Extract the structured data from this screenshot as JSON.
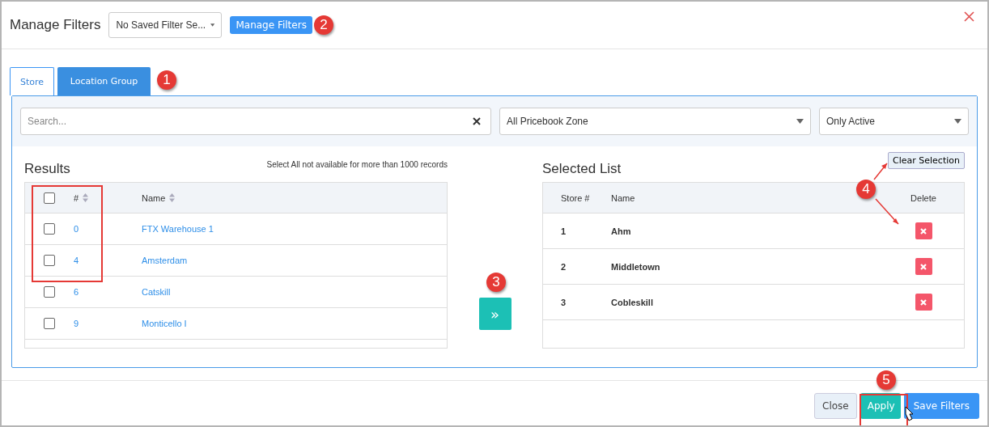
{
  "dialog": {
    "title": "Manage Filters",
    "saved_filter_select": {
      "value": "No Saved Filter Se..."
    },
    "manage_filters_button": "Manage Filters"
  },
  "tabs": [
    {
      "label": "Store",
      "selected": true
    },
    {
      "label": "Location Group",
      "selected": false
    }
  ],
  "filters": {
    "search": {
      "placeholder": "Search..."
    },
    "zone_select": {
      "value": "All Pricebook Zone"
    },
    "status_select": {
      "value": "Only Active"
    }
  },
  "results": {
    "title": "Results",
    "note": "Select All not available for more than 1000 records",
    "columns": [
      "#",
      "Name"
    ],
    "select_all_checked": false,
    "rows": [
      {
        "number": "0",
        "name": "FTX Warehouse 1",
        "checked": false
      },
      {
        "number": "4",
        "name": "Amsterdam",
        "checked": false
      },
      {
        "number": "6",
        "name": "Catskill",
        "checked": false
      },
      {
        "number": "9",
        "name": "Monticello I",
        "checked": false
      }
    ]
  },
  "move_button": "»",
  "selected_list": {
    "title": "Selected List",
    "clear_button": "Clear Selection",
    "columns": [
      "Store #",
      "Name",
      "Delete"
    ],
    "rows": [
      {
        "number": "1",
        "name": "Ahm"
      },
      {
        "number": "2",
        "name": "Middletown"
      },
      {
        "number": "3",
        "name": "Cobleskill"
      }
    ]
  },
  "footer": {
    "buttons": [
      {
        "label": "Close",
        "kind": "default"
      },
      {
        "label": "Apply",
        "kind": "primary"
      },
      {
        "label": "Save Filters",
        "kind": "info"
      }
    ]
  },
  "annotations": [
    {
      "number": "1"
    },
    {
      "number": "2"
    },
    {
      "number": "3"
    },
    {
      "number": "4"
    },
    {
      "number": "5"
    }
  ]
}
